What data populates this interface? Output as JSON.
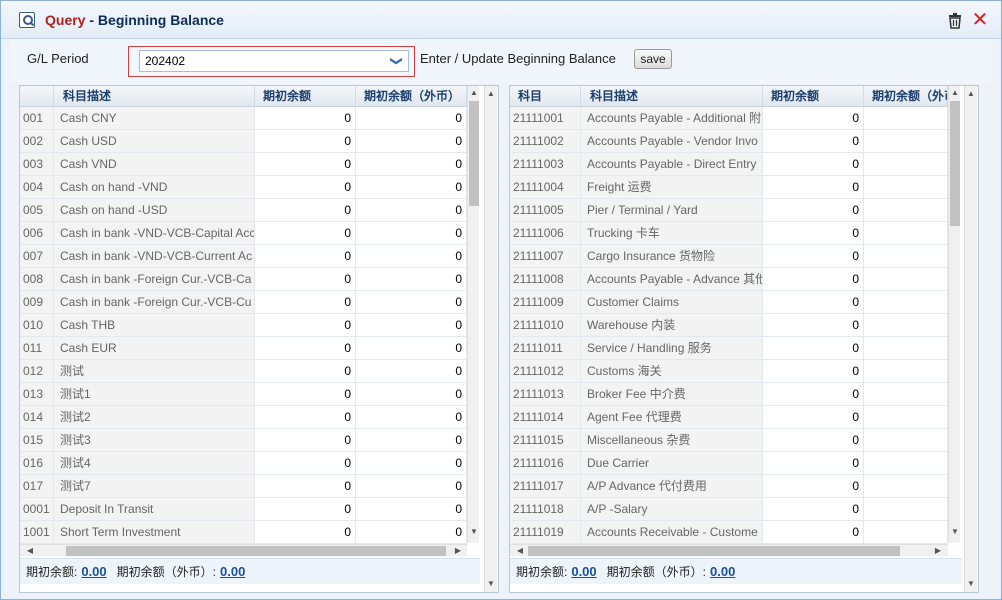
{
  "window": {
    "title_prefix": "Query",
    "title_sep": " - ",
    "title_main": "Beginning Balance",
    "close_glyph": "✕"
  },
  "filter": {
    "period_label": "G/L Period",
    "period_value": "202402",
    "enter_label": "Enter / Update Beginning Balance",
    "save_label": "save",
    "arrow_glyph": "❯"
  },
  "left_grid": {
    "headers": [
      "科目描述",
      "期初余额",
      "期初余额（外币）"
    ],
    "rows": [
      {
        "code": "001",
        "desc": "Cash CNY",
        "bal": "0",
        "fx": "0"
      },
      {
        "code": "002",
        "desc": "Cash USD",
        "bal": "0",
        "fx": "0"
      },
      {
        "code": "003",
        "desc": "Cash VND",
        "bal": "0",
        "fx": "0"
      },
      {
        "code": "004",
        "desc": "Cash on hand -VND",
        "bal": "0",
        "fx": "0"
      },
      {
        "code": "005",
        "desc": "Cash on hand -USD",
        "bal": "0",
        "fx": "0"
      },
      {
        "code": "006",
        "desc": "Cash in bank -VND-VCB-Capital Acc",
        "bal": "0",
        "fx": "0"
      },
      {
        "code": "007",
        "desc": "Cash in bank -VND-VCB-Current Ac",
        "bal": "0",
        "fx": "0"
      },
      {
        "code": "008",
        "desc": "Cash in bank -Foreign Cur.-VCB-Ca",
        "bal": "0",
        "fx": "0"
      },
      {
        "code": "009",
        "desc": "Cash in bank -Foreign Cur.-VCB-Cu",
        "bal": "0",
        "fx": "0"
      },
      {
        "code": "010",
        "desc": "Cash THB",
        "bal": "0",
        "fx": "0"
      },
      {
        "code": "011",
        "desc": "Cash EUR",
        "bal": "0",
        "fx": "0"
      },
      {
        "code": "012",
        "desc": "测试",
        "bal": "0",
        "fx": "0"
      },
      {
        "code": "013",
        "desc": "测试1",
        "bal": "0",
        "fx": "0"
      },
      {
        "code": "014",
        "desc": "测试2",
        "bal": "0",
        "fx": "0"
      },
      {
        "code": "015",
        "desc": "测试3",
        "bal": "0",
        "fx": "0"
      },
      {
        "code": "016",
        "desc": "测试4",
        "bal": "0",
        "fx": "0"
      },
      {
        "code": "017",
        "desc": "测试7",
        "bal": "0",
        "fx": "0"
      },
      {
        "code": "0001",
        "desc": "Deposit In Transit",
        "bal": "0",
        "fx": "0"
      },
      {
        "code": "1001",
        "desc": "Short Term Investment",
        "bal": "0",
        "fx": "0"
      }
    ],
    "footer_label1": "期初余额:",
    "footer_value1": "0.00",
    "footer_label2": "期初余额（外币）:",
    "footer_value2": "0.00"
  },
  "right_grid": {
    "headers": [
      "科目",
      "科目描述",
      "期初余额",
      "期初余额（外币）"
    ],
    "rows": [
      {
        "code": "21111001",
        "desc": "Accounts Payable - Additional 附",
        "bal": "0"
      },
      {
        "code": "21111002",
        "desc": "Accounts Payable - Vendor Invo",
        "bal": "0"
      },
      {
        "code": "21111003",
        "desc": "Accounts Payable - Direct Entry",
        "bal": "0"
      },
      {
        "code": "21111004",
        "desc": "Freight 运费",
        "bal": "0"
      },
      {
        "code": "21111005",
        "desc": "Pier / Terminal / Yard",
        "bal": "0"
      },
      {
        "code": "21111006",
        "desc": "Trucking 卡车",
        "bal": "0"
      },
      {
        "code": "21111007",
        "desc": "Cargo Insurance 货物险",
        "bal": "0"
      },
      {
        "code": "21111008",
        "desc": "Accounts Payable - Advance 其他",
        "bal": "0"
      },
      {
        "code": "21111009",
        "desc": "Customer Claims",
        "bal": "0"
      },
      {
        "code": "21111010",
        "desc": "Warehouse 内装",
        "bal": "0"
      },
      {
        "code": "21111011",
        "desc": "Service / Handling 服务",
        "bal": "0"
      },
      {
        "code": "21111012",
        "desc": "Customs 海关",
        "bal": "0"
      },
      {
        "code": "21111013",
        "desc": "Broker Fee 中介费",
        "bal": "0"
      },
      {
        "code": "21111014",
        "desc": "Agent Fee 代理费",
        "bal": "0"
      },
      {
        "code": "21111015",
        "desc": "Miscellaneous 杂费",
        "bal": "0"
      },
      {
        "code": "21111016",
        "desc": "Due Carrier",
        "bal": "0"
      },
      {
        "code": "21111017",
        "desc": "A/P Advance 代付费用",
        "bal": "0"
      },
      {
        "code": "21111018",
        "desc": "A/P -Salary",
        "bal": "0"
      },
      {
        "code": "21111019",
        "desc": "Accounts Receivable - Custome",
        "bal": "0"
      }
    ],
    "footer_label1": "期初余额:",
    "footer_value1": "0.00",
    "footer_label2": "期初余额（外币）:",
    "footer_value2": "0.00"
  }
}
